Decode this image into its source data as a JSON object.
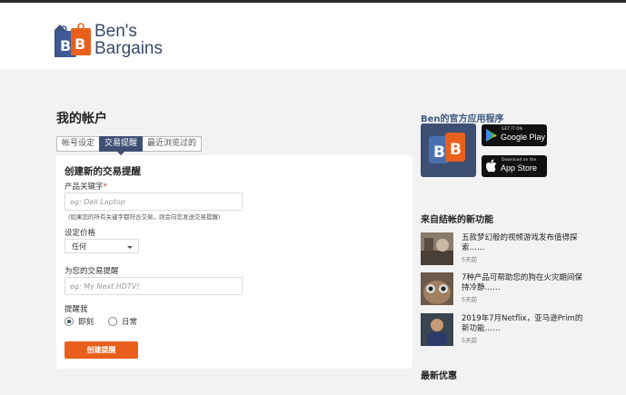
{
  "brand": {
    "line1": "Ben's",
    "line2": "Bargains",
    "mark_letters": "BB"
  },
  "page_title": "我的帐户",
  "tabs": [
    {
      "label": "帐号设定",
      "active": false
    },
    {
      "label": "交易提醒",
      "active": true
    },
    {
      "label": "最近浏览过的",
      "active": false
    }
  ],
  "form": {
    "title": "创建新的交易提醒",
    "keyword_label": "产品关键字",
    "required_mark": "*",
    "keyword_placeholder": "eg: Dell Laptop",
    "keyword_hint": "(如果您的所有关键字都符合交易，则会向您发送交易提醒)",
    "price_label": "设定价格",
    "price_value": "任何",
    "name_label": "为您的交易提醒",
    "name_placeholder": "eg: My Next HDTV!",
    "remind_label": "提醒我",
    "remind_options": [
      {
        "label": "即刻",
        "checked": true
      },
      {
        "label": "日常",
        "checked": false
      }
    ],
    "submit_label": "创建提醒"
  },
  "sidebar": {
    "app_title": "Ben的官方应用程序",
    "google_play": {
      "small": "GET IT ON",
      "big": "Google Play"
    },
    "app_store": {
      "small": "Download on the",
      "big": "App Store"
    },
    "blog_title": "来自结帐的新功能",
    "blog_items": [
      {
        "title": "五款梦幻般的视频游戏发布值得探索……",
        "time": "5天前"
      },
      {
        "title": "7种产品可帮助您的狗在火灾期间保持冷静……",
        "time": "5天前"
      },
      {
        "title": "2019年7月Netflix，亚马逊Prim的新功能……",
        "time": "5天前"
      }
    ],
    "deals_title": "最新优惠"
  },
  "colors": {
    "brand_blue": "#3d4f73",
    "brand_orange": "#e8601c",
    "background": "#f2f2f2"
  }
}
